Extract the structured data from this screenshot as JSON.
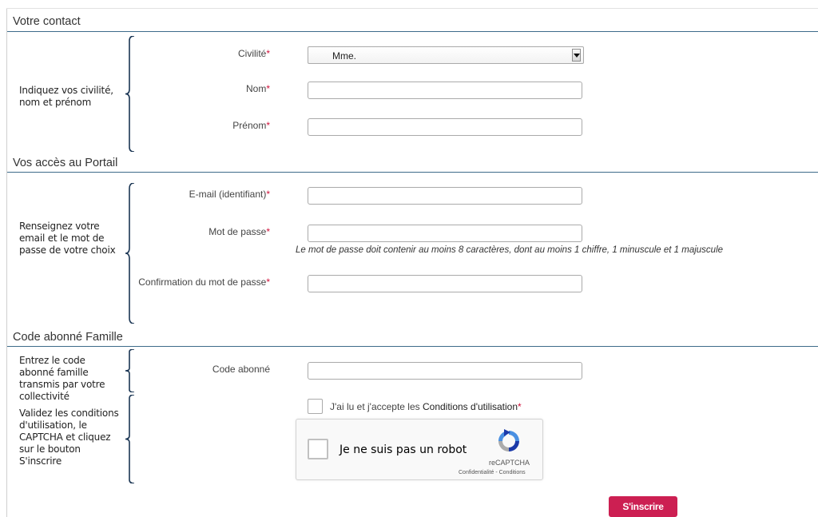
{
  "sections": {
    "contact": {
      "title": "Votre contact",
      "hint": "Indiquez vos civilité, nom et prénom",
      "civilite": {
        "label": "Civilité",
        "required_mark": "*",
        "selected": "Mme."
      },
      "nom": {
        "label": "Nom",
        "required_mark": "*",
        "value": ""
      },
      "prenom": {
        "label": "Prénom",
        "required_mark": "*",
        "value": ""
      }
    },
    "acces": {
      "title": "Vos accès au Portail",
      "hint": "Renseignez votre email et le mot de passe de votre choix",
      "email": {
        "label": "E-mail (identifiant)",
        "required_mark": "*",
        "value": ""
      },
      "password": {
        "label": "Mot de passe",
        "required_mark": "*",
        "value": "",
        "help": "Le mot de passe doit contenir au moins 8 caractères, dont au moins 1 chiffre, 1 minuscule et 1 majuscule"
      },
      "password_confirm": {
        "label": "Confirmation du mot de passe",
        "required_mark": "*",
        "value": ""
      }
    },
    "code": {
      "title": "Code abonné Famille",
      "hint": "Entrez le code abonné famille transmis par votre collectivité",
      "code_abonne": {
        "label": "Code abonné",
        "value": ""
      }
    },
    "validation": {
      "hint": "Validez les conditions d'utilisation, le CAPTCHA et cliquez sur le bouton S'inscrire",
      "cgu": {
        "text": "J'ai lu et j'accepte les ",
        "link": "Conditions d'utilisation",
        "required_mark": "*",
        "checked": false
      },
      "recaptcha": {
        "label": "Je ne suis pas un robot",
        "brand": "reCAPTCHA",
        "privacy": "Confidentialité",
        "separator": " - ",
        "terms": "Conditions",
        "checked": false
      }
    }
  },
  "submit": {
    "label": "S'inscrire"
  },
  "colors": {
    "accent": "#cc1f52",
    "section_rule": "#3d6b8a",
    "required": "#d0103a"
  },
  "icons": {
    "brace": "left-curly-brace",
    "recaptcha": "recaptcha-logo",
    "select_arrow": "chevron-down"
  }
}
